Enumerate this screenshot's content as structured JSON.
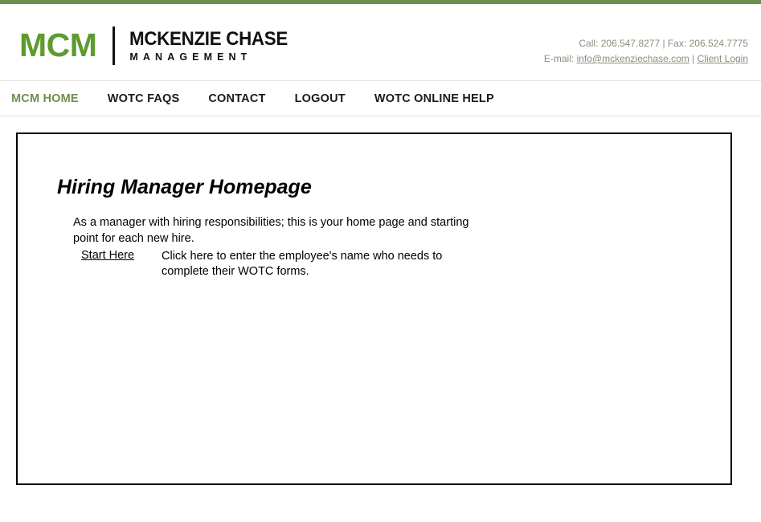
{
  "brand": {
    "logo_mark": "MCM",
    "logo_name_line1": "MCKENZIE CHASE",
    "logo_name_line2": "MANAGEMENT",
    "accent_green": "#6d8f4d",
    "logo_green": "#5d9b2f"
  },
  "header": {
    "call_label": "Call:",
    "phone": "206.547.8277",
    "separator": "|",
    "fax_label": "Fax:",
    "fax": "206.524.7775",
    "email_label": "E-mail:",
    "email": "info@mckenziechase.com",
    "client_login": "Client Login",
    "line1": "Call: 206.547.8277 | Fax: 206.524.7775"
  },
  "nav": {
    "items": [
      {
        "label": "MCM HOME",
        "active": true
      },
      {
        "label": "WOTC FAQS",
        "active": false
      },
      {
        "label": "CONTACT",
        "active": false
      },
      {
        "label": "LOGOUT",
        "active": false
      },
      {
        "label": "WOTC ONLINE HELP",
        "active": false
      }
    ]
  },
  "main": {
    "title": "Hiring Manager Homepage",
    "intro": "As a manager with hiring responsibilities; this is your home page and starting point for each new hire.",
    "start_link_label": "Start Here",
    "start_description": "Click here to enter the employee's name who needs to complete their WOTC forms."
  }
}
